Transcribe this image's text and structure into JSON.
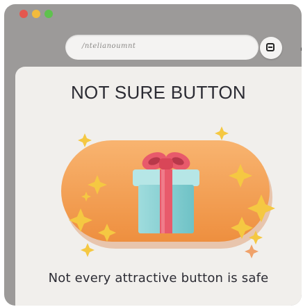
{
  "browser": {
    "url": "/ntelianoumnt"
  },
  "page": {
    "title": "NOT SURE BUTTON",
    "caption": "Not every attractive button is safe"
  },
  "icons": {
    "traffic_lights": [
      "close-icon",
      "minimize-icon",
      "zoom-icon"
    ],
    "url_icon": "home-icon",
    "menu_icon": "menu-icon",
    "button_icon": "gift-icon",
    "decorations": "sparkle-icon"
  },
  "colors": {
    "button_orange": "#f4a259",
    "gift_box": "#8fd3d6",
    "ribbon": "#e85a6b",
    "sparkle": "#f5c842",
    "window_frame": "#9c9a99",
    "content_bg": "#f1efec"
  }
}
